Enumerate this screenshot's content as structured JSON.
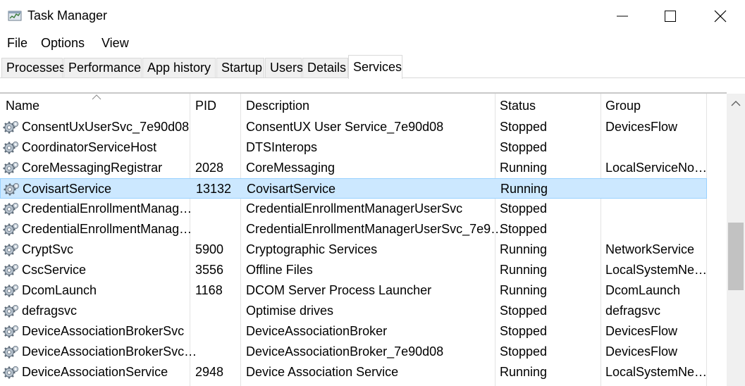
{
  "window": {
    "title": "Task Manager",
    "icon": "task-manager-icon"
  },
  "menu": [
    "File",
    "Options",
    "View"
  ],
  "tabs": [
    {
      "label": "Processes"
    },
    {
      "label": "Performance"
    },
    {
      "label": "App history"
    },
    {
      "label": "Startup"
    },
    {
      "label": "Users"
    },
    {
      "label": "Details"
    },
    {
      "label": "Services",
      "active": true
    }
  ],
  "columns": {
    "name": "Name",
    "pid": "PID",
    "description": "Description",
    "status": "Status",
    "group": "Group"
  },
  "sort": {
    "column": "Name",
    "direction": "ascending"
  },
  "rows": [
    {
      "name": "ConsentUxUserSvc_7e90d08",
      "pid": "",
      "description": "ConsentUX User Service_7e90d08",
      "status": "Stopped",
      "group": "DevicesFlow"
    },
    {
      "name": "CoordinatorServiceHost",
      "pid": "",
      "description": "DTSInterops",
      "status": "Stopped",
      "group": ""
    },
    {
      "name": "CoreMessagingRegistrar",
      "pid": "2028",
      "description": "CoreMessaging",
      "status": "Running",
      "group": "LocalServiceNo…"
    },
    {
      "name": "CovisartService",
      "pid": "13132",
      "description": "CovisartService",
      "status": "Running",
      "group": "",
      "selected": true
    },
    {
      "name": "CredentialEnrollmentManag…",
      "pid": "",
      "description": "CredentialEnrollmentManagerUserSvc",
      "status": "Stopped",
      "group": ""
    },
    {
      "name": "CredentialEnrollmentManag…",
      "pid": "",
      "description": "CredentialEnrollmentManagerUserSvc_7e9…",
      "status": "Stopped",
      "group": ""
    },
    {
      "name": "CryptSvc",
      "pid": "5900",
      "description": "Cryptographic Services",
      "status": "Running",
      "group": "NetworkService"
    },
    {
      "name": "CscService",
      "pid": "3556",
      "description": "Offline Files",
      "status": "Running",
      "group": "LocalSystemNe…"
    },
    {
      "name": "DcomLaunch",
      "pid": "1168",
      "description": "DCOM Server Process Launcher",
      "status": "Running",
      "group": "DcomLaunch"
    },
    {
      "name": "defragsvc",
      "pid": "",
      "description": "Optimise drives",
      "status": "Stopped",
      "group": "defragsvc"
    },
    {
      "name": "DeviceAssociationBrokerSvc",
      "pid": "",
      "description": "DeviceAssociationBroker",
      "status": "Stopped",
      "group": "DevicesFlow"
    },
    {
      "name": "DeviceAssociationBrokerSvc…",
      "pid": "",
      "description": "DeviceAssociationBroker_7e90d08",
      "status": "Stopped",
      "group": "DevicesFlow"
    },
    {
      "name": "DeviceAssociationService",
      "pid": "2948",
      "description": "Device Association Service",
      "status": "Running",
      "group": "LocalSystemNe…"
    }
  ],
  "colors": {
    "selection_bg": "#cce8ff",
    "selection_border": "#99d1ff"
  }
}
